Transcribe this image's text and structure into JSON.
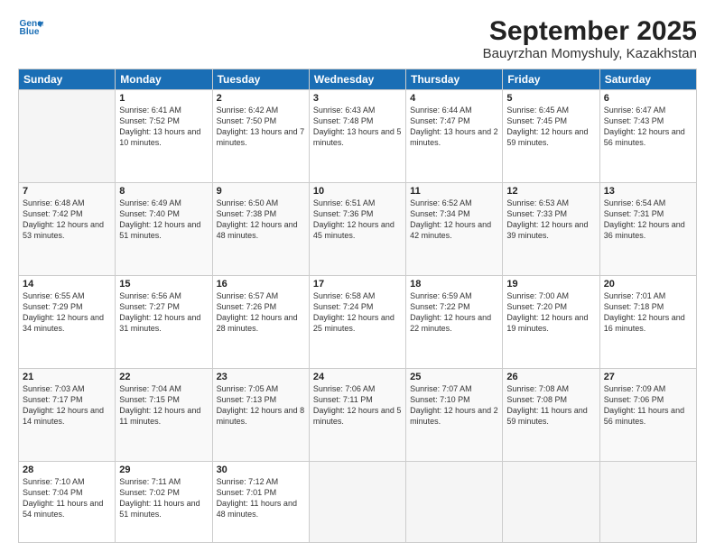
{
  "logo": {
    "line1": "General",
    "line2": "Blue"
  },
  "title": "September 2025",
  "location": "Bauyrzhan Momyshuly, Kazakhstan",
  "weekdays": [
    "Sunday",
    "Monday",
    "Tuesday",
    "Wednesday",
    "Thursday",
    "Friday",
    "Saturday"
  ],
  "weeks": [
    [
      {
        "day": "",
        "sunrise": "",
        "sunset": "",
        "daylight": ""
      },
      {
        "day": "1",
        "sunrise": "Sunrise: 6:41 AM",
        "sunset": "Sunset: 7:52 PM",
        "daylight": "Daylight: 13 hours and 10 minutes."
      },
      {
        "day": "2",
        "sunrise": "Sunrise: 6:42 AM",
        "sunset": "Sunset: 7:50 PM",
        "daylight": "Daylight: 13 hours and 7 minutes."
      },
      {
        "day": "3",
        "sunrise": "Sunrise: 6:43 AM",
        "sunset": "Sunset: 7:48 PM",
        "daylight": "Daylight: 13 hours and 5 minutes."
      },
      {
        "day": "4",
        "sunrise": "Sunrise: 6:44 AM",
        "sunset": "Sunset: 7:47 PM",
        "daylight": "Daylight: 13 hours and 2 minutes."
      },
      {
        "day": "5",
        "sunrise": "Sunrise: 6:45 AM",
        "sunset": "Sunset: 7:45 PM",
        "daylight": "Daylight: 12 hours and 59 minutes."
      },
      {
        "day": "6",
        "sunrise": "Sunrise: 6:47 AM",
        "sunset": "Sunset: 7:43 PM",
        "daylight": "Daylight: 12 hours and 56 minutes."
      }
    ],
    [
      {
        "day": "7",
        "sunrise": "Sunrise: 6:48 AM",
        "sunset": "Sunset: 7:42 PM",
        "daylight": "Daylight: 12 hours and 53 minutes."
      },
      {
        "day": "8",
        "sunrise": "Sunrise: 6:49 AM",
        "sunset": "Sunset: 7:40 PM",
        "daylight": "Daylight: 12 hours and 51 minutes."
      },
      {
        "day": "9",
        "sunrise": "Sunrise: 6:50 AM",
        "sunset": "Sunset: 7:38 PM",
        "daylight": "Daylight: 12 hours and 48 minutes."
      },
      {
        "day": "10",
        "sunrise": "Sunrise: 6:51 AM",
        "sunset": "Sunset: 7:36 PM",
        "daylight": "Daylight: 12 hours and 45 minutes."
      },
      {
        "day": "11",
        "sunrise": "Sunrise: 6:52 AM",
        "sunset": "Sunset: 7:34 PM",
        "daylight": "Daylight: 12 hours and 42 minutes."
      },
      {
        "day": "12",
        "sunrise": "Sunrise: 6:53 AM",
        "sunset": "Sunset: 7:33 PM",
        "daylight": "Daylight: 12 hours and 39 minutes."
      },
      {
        "day": "13",
        "sunrise": "Sunrise: 6:54 AM",
        "sunset": "Sunset: 7:31 PM",
        "daylight": "Daylight: 12 hours and 36 minutes."
      }
    ],
    [
      {
        "day": "14",
        "sunrise": "Sunrise: 6:55 AM",
        "sunset": "Sunset: 7:29 PM",
        "daylight": "Daylight: 12 hours and 34 minutes."
      },
      {
        "day": "15",
        "sunrise": "Sunrise: 6:56 AM",
        "sunset": "Sunset: 7:27 PM",
        "daylight": "Daylight: 12 hours and 31 minutes."
      },
      {
        "day": "16",
        "sunrise": "Sunrise: 6:57 AM",
        "sunset": "Sunset: 7:26 PM",
        "daylight": "Daylight: 12 hours and 28 minutes."
      },
      {
        "day": "17",
        "sunrise": "Sunrise: 6:58 AM",
        "sunset": "Sunset: 7:24 PM",
        "daylight": "Daylight: 12 hours and 25 minutes."
      },
      {
        "day": "18",
        "sunrise": "Sunrise: 6:59 AM",
        "sunset": "Sunset: 7:22 PM",
        "daylight": "Daylight: 12 hours and 22 minutes."
      },
      {
        "day": "19",
        "sunrise": "Sunrise: 7:00 AM",
        "sunset": "Sunset: 7:20 PM",
        "daylight": "Daylight: 12 hours and 19 minutes."
      },
      {
        "day": "20",
        "sunrise": "Sunrise: 7:01 AM",
        "sunset": "Sunset: 7:18 PM",
        "daylight": "Daylight: 12 hours and 16 minutes."
      }
    ],
    [
      {
        "day": "21",
        "sunrise": "Sunrise: 7:03 AM",
        "sunset": "Sunset: 7:17 PM",
        "daylight": "Daylight: 12 hours and 14 minutes."
      },
      {
        "day": "22",
        "sunrise": "Sunrise: 7:04 AM",
        "sunset": "Sunset: 7:15 PM",
        "daylight": "Daylight: 12 hours and 11 minutes."
      },
      {
        "day": "23",
        "sunrise": "Sunrise: 7:05 AM",
        "sunset": "Sunset: 7:13 PM",
        "daylight": "Daylight: 12 hours and 8 minutes."
      },
      {
        "day": "24",
        "sunrise": "Sunrise: 7:06 AM",
        "sunset": "Sunset: 7:11 PM",
        "daylight": "Daylight: 12 hours and 5 minutes."
      },
      {
        "day": "25",
        "sunrise": "Sunrise: 7:07 AM",
        "sunset": "Sunset: 7:10 PM",
        "daylight": "Daylight: 12 hours and 2 minutes."
      },
      {
        "day": "26",
        "sunrise": "Sunrise: 7:08 AM",
        "sunset": "Sunset: 7:08 PM",
        "daylight": "Daylight: 11 hours and 59 minutes."
      },
      {
        "day": "27",
        "sunrise": "Sunrise: 7:09 AM",
        "sunset": "Sunset: 7:06 PM",
        "daylight": "Daylight: 11 hours and 56 minutes."
      }
    ],
    [
      {
        "day": "28",
        "sunrise": "Sunrise: 7:10 AM",
        "sunset": "Sunset: 7:04 PM",
        "daylight": "Daylight: 11 hours and 54 minutes."
      },
      {
        "day": "29",
        "sunrise": "Sunrise: 7:11 AM",
        "sunset": "Sunset: 7:02 PM",
        "daylight": "Daylight: 11 hours and 51 minutes."
      },
      {
        "day": "30",
        "sunrise": "Sunrise: 7:12 AM",
        "sunset": "Sunset: 7:01 PM",
        "daylight": "Daylight: 11 hours and 48 minutes."
      },
      {
        "day": "",
        "sunrise": "",
        "sunset": "",
        "daylight": ""
      },
      {
        "day": "",
        "sunrise": "",
        "sunset": "",
        "daylight": ""
      },
      {
        "day": "",
        "sunrise": "",
        "sunset": "",
        "daylight": ""
      },
      {
        "day": "",
        "sunrise": "",
        "sunset": "",
        "daylight": ""
      }
    ]
  ]
}
